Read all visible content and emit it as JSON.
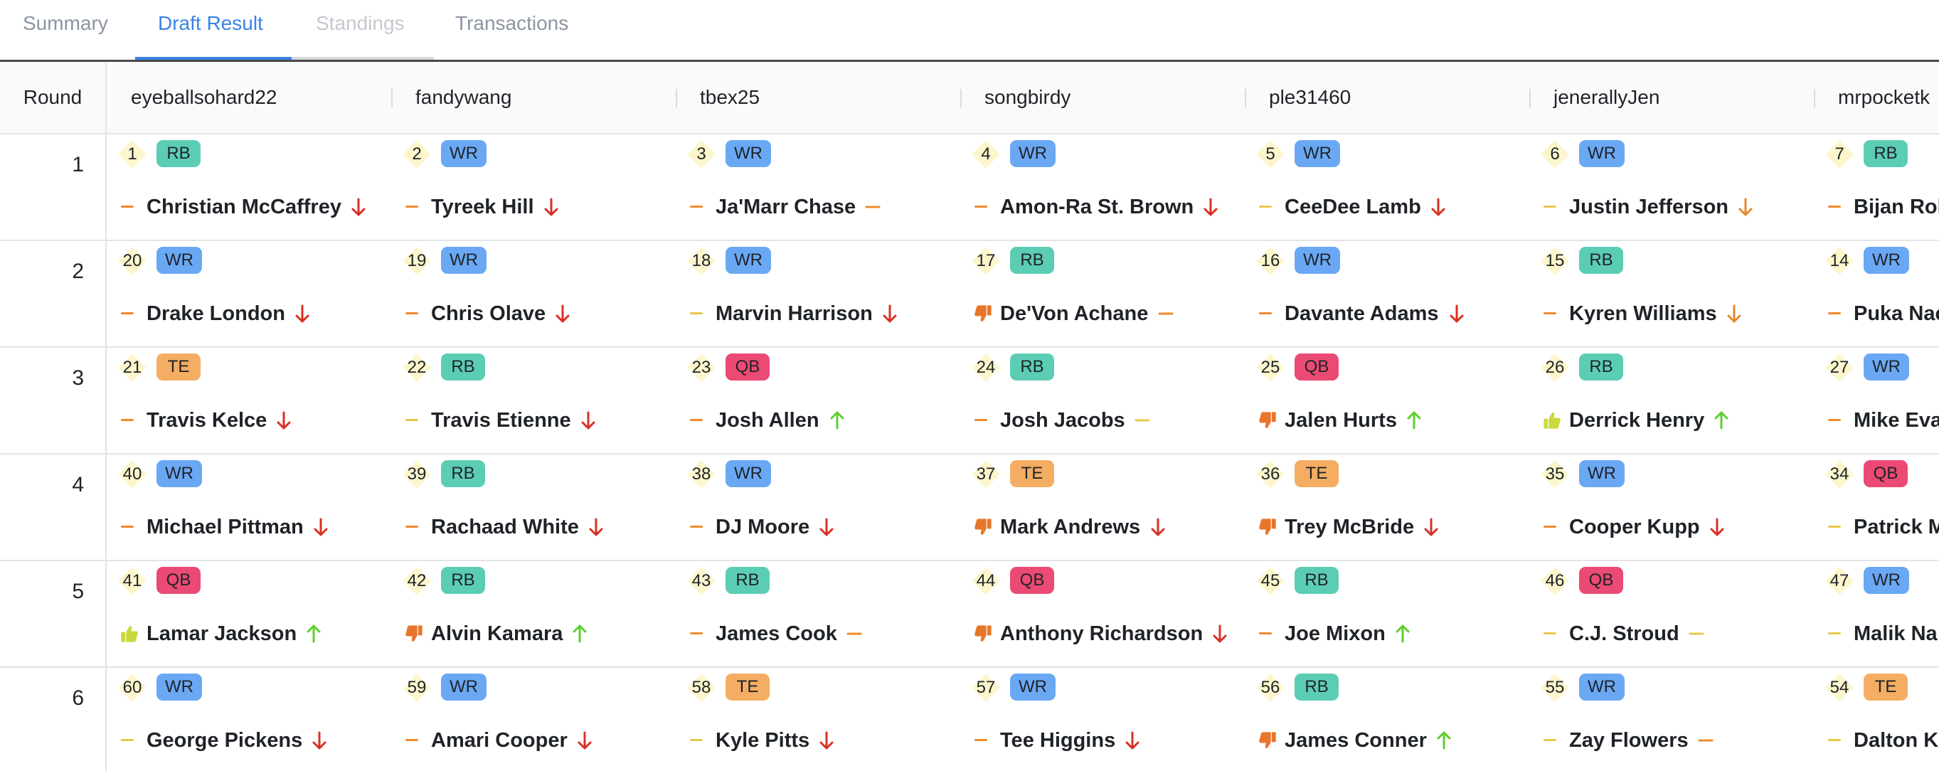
{
  "tabs": [
    {
      "label": "Summary",
      "state": "normal"
    },
    {
      "label": "Draft Result",
      "state": "active"
    },
    {
      "label": "Standings",
      "state": "disabled"
    },
    {
      "label": "Transactions",
      "state": "normal"
    }
  ],
  "table": {
    "round_header": "Round",
    "teams": [
      "eyeballsohard22",
      "fandywang",
      "tbex25",
      "songbirdy",
      "ple31460",
      "jenerallyJen",
      "mrpocketk"
    ],
    "rounds": [
      {
        "round": "1",
        "picks": [
          {
            "pick": "1",
            "pos": "RB",
            "player": "Christian McCaffrey",
            "grade": "dash-orange",
            "trend": "down"
          },
          {
            "pick": "2",
            "pos": "WR",
            "player": "Tyreek Hill",
            "grade": "dash-orange",
            "trend": "down"
          },
          {
            "pick": "3",
            "pos": "WR",
            "player": "Ja'Marr Chase",
            "grade": "dash-orange",
            "trend": "flat-orange"
          },
          {
            "pick": "4",
            "pos": "WR",
            "player": "Amon-Ra St. Brown",
            "grade": "dash-orange",
            "trend": "down"
          },
          {
            "pick": "5",
            "pos": "WR",
            "player": "CeeDee Lamb",
            "grade": "dash-yellow",
            "trend": "down"
          },
          {
            "pick": "6",
            "pos": "WR",
            "player": "Justin Jefferson",
            "grade": "dash-yellow",
            "trend": "down-orange"
          },
          {
            "pick": "7",
            "pos": "RB",
            "player": "Bijan Rol",
            "grade": "dash-orange",
            "trend": "none"
          }
        ]
      },
      {
        "round": "2",
        "picks": [
          {
            "pick": "20",
            "pos": "WR",
            "player": "Drake London",
            "grade": "dash-orange",
            "trend": "down"
          },
          {
            "pick": "19",
            "pos": "WR",
            "player": "Chris Olave",
            "grade": "dash-orange",
            "trend": "down"
          },
          {
            "pick": "18",
            "pos": "WR",
            "player": "Marvin Harrison",
            "grade": "dash-yellow",
            "trend": "down"
          },
          {
            "pick": "17",
            "pos": "RB",
            "player": "De'Von Achane",
            "grade": "thumb-down",
            "trend": "flat-orange"
          },
          {
            "pick": "16",
            "pos": "WR",
            "player": "Davante Adams",
            "grade": "dash-orange",
            "trend": "down"
          },
          {
            "pick": "15",
            "pos": "RB",
            "player": "Kyren Williams",
            "grade": "dash-orange",
            "trend": "down-orange"
          },
          {
            "pick": "14",
            "pos": "WR",
            "player": "Puka Nac",
            "grade": "dash-orange",
            "trend": "none"
          }
        ]
      },
      {
        "round": "3",
        "picks": [
          {
            "pick": "21",
            "pos": "TE",
            "player": "Travis Kelce",
            "grade": "dash-orange",
            "trend": "down"
          },
          {
            "pick": "22",
            "pos": "RB",
            "player": "Travis Etienne",
            "grade": "dash-yellow",
            "trend": "down"
          },
          {
            "pick": "23",
            "pos": "QB",
            "player": "Josh Allen",
            "grade": "dash-orange",
            "trend": "up"
          },
          {
            "pick": "24",
            "pos": "RB",
            "player": "Josh Jacobs",
            "grade": "dash-orange",
            "trend": "flat-yellow"
          },
          {
            "pick": "25",
            "pos": "QB",
            "player": "Jalen Hurts",
            "grade": "thumb-down",
            "trend": "up"
          },
          {
            "pick": "26",
            "pos": "RB",
            "player": "Derrick Henry",
            "grade": "thumb-up",
            "trend": "up"
          },
          {
            "pick": "27",
            "pos": "WR",
            "player": "Mike Eva",
            "grade": "dash-orange",
            "trend": "none"
          }
        ]
      },
      {
        "round": "4",
        "picks": [
          {
            "pick": "40",
            "pos": "WR",
            "player": "Michael Pittman",
            "grade": "dash-orange",
            "trend": "down"
          },
          {
            "pick": "39",
            "pos": "RB",
            "player": "Rachaad White",
            "grade": "dash-orange",
            "trend": "down"
          },
          {
            "pick": "38",
            "pos": "WR",
            "player": "DJ Moore",
            "grade": "dash-orange",
            "trend": "down"
          },
          {
            "pick": "37",
            "pos": "TE",
            "player": "Mark Andrews",
            "grade": "thumb-down",
            "trend": "down"
          },
          {
            "pick": "36",
            "pos": "TE",
            "player": "Trey McBride",
            "grade": "thumb-down",
            "trend": "down"
          },
          {
            "pick": "35",
            "pos": "WR",
            "player": "Cooper Kupp",
            "grade": "dash-orange",
            "trend": "down"
          },
          {
            "pick": "34",
            "pos": "QB",
            "player": "Patrick M",
            "grade": "dash-yellow",
            "trend": "none"
          }
        ]
      },
      {
        "round": "5",
        "picks": [
          {
            "pick": "41",
            "pos": "QB",
            "player": "Lamar Jackson",
            "grade": "thumb-up",
            "trend": "up"
          },
          {
            "pick": "42",
            "pos": "RB",
            "player": "Alvin Kamara",
            "grade": "thumb-down",
            "trend": "up"
          },
          {
            "pick": "43",
            "pos": "RB",
            "player": "James Cook",
            "grade": "dash-orange",
            "trend": "flat-orange"
          },
          {
            "pick": "44",
            "pos": "QB",
            "player": "Anthony Richardson",
            "grade": "thumb-down",
            "trend": "down"
          },
          {
            "pick": "45",
            "pos": "RB",
            "player": "Joe Mixon",
            "grade": "dash-orange",
            "trend": "up"
          },
          {
            "pick": "46",
            "pos": "QB",
            "player": "C.J. Stroud",
            "grade": "dash-yellow",
            "trend": "flat-yellow"
          },
          {
            "pick": "47",
            "pos": "WR",
            "player": "Malik Na",
            "grade": "dash-yellow",
            "trend": "none"
          }
        ]
      },
      {
        "round": "6",
        "picks": [
          {
            "pick": "60",
            "pos": "WR",
            "player": "George Pickens",
            "grade": "dash-yellow",
            "trend": "down"
          },
          {
            "pick": "59",
            "pos": "WR",
            "player": "Amari Cooper",
            "grade": "dash-orange",
            "trend": "down"
          },
          {
            "pick": "58",
            "pos": "TE",
            "player": "Kyle Pitts",
            "grade": "dash-yellow",
            "trend": "down"
          },
          {
            "pick": "57",
            "pos": "WR",
            "player": "Tee Higgins",
            "grade": "dash-orange",
            "trend": "down"
          },
          {
            "pick": "56",
            "pos": "RB",
            "player": "James Conner",
            "grade": "thumb-down",
            "trend": "up"
          },
          {
            "pick": "55",
            "pos": "WR",
            "player": "Zay Flowers",
            "grade": "dash-yellow",
            "trend": "flat-orange"
          },
          {
            "pick": "54",
            "pos": "TE",
            "player": "Dalton K",
            "grade": "dash-yellow",
            "trend": "none"
          }
        ]
      }
    ]
  },
  "colors": {
    "accent": "#3b82e6",
    "RB": "#5ccdb5",
    "WR": "#6aa8f4",
    "TE": "#f4ad62",
    "QB": "#ea4a73",
    "trend_down": "#d93025",
    "trend_down_orange": "#e8862a",
    "trend_up": "#5ccf2f",
    "dash_orange": "#f08a2a",
    "dash_yellow": "#e8c84a",
    "thumb_down": "#e8762a",
    "thumb_up": "#c9d93a"
  }
}
